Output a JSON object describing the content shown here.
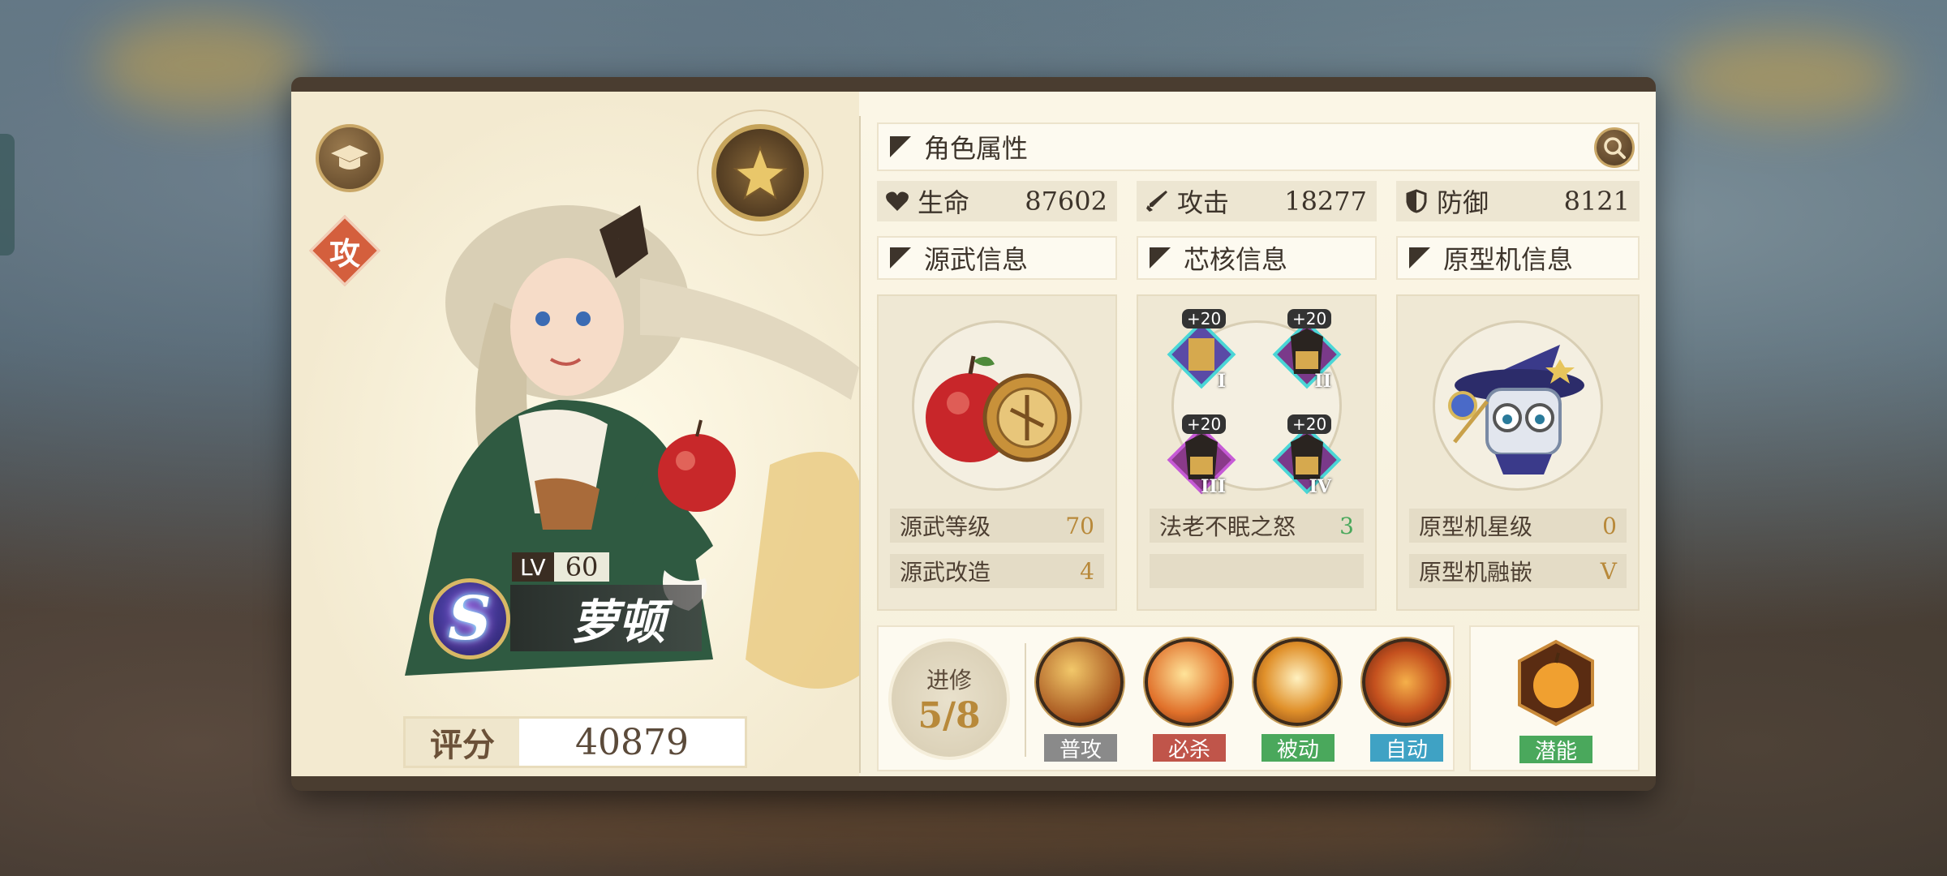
{
  "colors": {
    "accent_brown": "#3d342b",
    "gold": "#b8893a",
    "role_orange": "#d45f3d",
    "tag_gray": "#8a8a8a",
    "tag_red": "#c0554a",
    "tag_green": "#4aa85c",
    "tag_blue": "#3fa2c4"
  },
  "left": {
    "role_icon_text": "攻",
    "level_label": "LV",
    "level_value": "60",
    "rank_letter": "S",
    "character_name": "萝顿",
    "score_label": "评分",
    "score_value": "40879"
  },
  "attributes": {
    "header": "角色属性",
    "hp_label": "生命",
    "hp_value": "87602",
    "atk_label": "攻击",
    "atk_value": "18277",
    "def_label": "防御",
    "def_value": "8121"
  },
  "weapon": {
    "header": "源武信息",
    "level_label": "源武等级",
    "level_value": "70",
    "refine_label": "源武改造",
    "refine_value": "4"
  },
  "core": {
    "header": "芯核信息",
    "slots": [
      {
        "plus": "+20",
        "roman": "I"
      },
      {
        "plus": "+20",
        "roman": "II"
      },
      {
        "plus": "+20",
        "roman": "III"
      },
      {
        "plus": "+20",
        "roman": "IV"
      }
    ],
    "set_label": "法老不眠之怒",
    "set_value": "3"
  },
  "prototype": {
    "header": "原型机信息",
    "star_label": "原型机星级",
    "star_value": "0",
    "inlay_label": "原型机融嵌",
    "inlay_value": "V"
  },
  "skills": {
    "advance_label": "进修",
    "advance_value": "5/8",
    "items": [
      {
        "tag": "普攻"
      },
      {
        "tag": "必杀"
      },
      {
        "tag": "被动"
      },
      {
        "tag": "自动"
      }
    ],
    "potential_tag": "潜能"
  }
}
